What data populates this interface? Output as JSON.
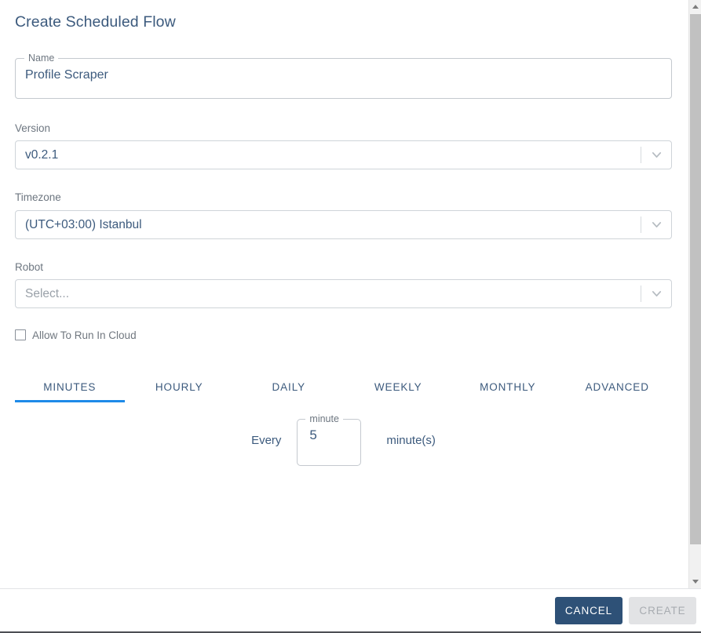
{
  "dialog": {
    "title": "Create Scheduled Flow"
  },
  "form": {
    "name": {
      "legend": "Name",
      "value": "Profile Scraper"
    },
    "version": {
      "label": "Version",
      "value": "v0.2.1",
      "placeholder": "Select..."
    },
    "timezone": {
      "label": "Timezone",
      "value": "(UTC+03:00) Istanbul",
      "placeholder": "Select..."
    },
    "robot": {
      "label": "Robot",
      "value": "",
      "placeholder": "Select..."
    },
    "allow_cloud": {
      "label": "Allow To Run In Cloud",
      "checked": false
    }
  },
  "tabs": {
    "active": "MINUTES",
    "items": [
      {
        "label": "MINUTES"
      },
      {
        "label": "HOURLY"
      },
      {
        "label": "DAILY"
      },
      {
        "label": "WEEKLY"
      },
      {
        "label": "MONTHLY"
      },
      {
        "label": "ADVANCED"
      }
    ]
  },
  "schedule": {
    "every_label": "Every",
    "unit_legend": "minute",
    "value": "5",
    "unit_suffix": "minute(s)"
  },
  "footer": {
    "cancel_label": "CANCEL",
    "create_label": "CREATE"
  },
  "icons": {
    "chevron_down": "chevron-down-icon",
    "scroll_up": "scroll-up-arrow-icon",
    "scroll_down": "scroll-down-arrow-icon"
  },
  "colors": {
    "accent_blue": "#1e8ae8",
    "primary_navy": "#2e5177",
    "text_slate": "#3c5a7d",
    "label_gray": "#6d7680",
    "border_gray": "#c4c9cf",
    "disabled_bg": "#e2e3e5"
  }
}
